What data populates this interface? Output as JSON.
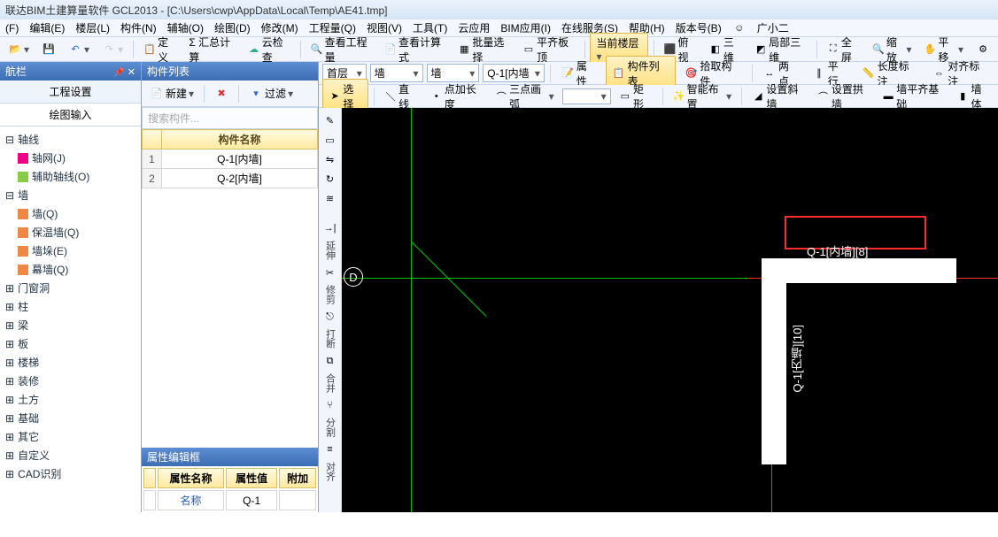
{
  "title": "联达BIM土建算量软件 GCL2013 - [C:\\Users\\cwp\\AppData\\Local\\Temp\\AE41.tmp]",
  "menu": {
    "file": "(F)",
    "edit": "编辑(E)",
    "floor": "楼层(L)",
    "component": "构件(N)",
    "aux": "辅轴(O)",
    "draw": "绘图(D)",
    "modify": "修改(M)",
    "qty": "工程量(Q)",
    "view": "视图(V)",
    "tool": "工具(T)",
    "cloud": "云应用",
    "bim": "BIM应用(I)",
    "online": "在线服务(S)",
    "help": "帮助(H)",
    "ver": "版本号(B)",
    "gxe": "广小二"
  },
  "toolbar1": {
    "define": "定义",
    "sum": "Σ 汇总计算",
    "cloudcheck": "云检查",
    "viewqty": "查看工程量",
    "viewcalc": "查看计算式",
    "batchsel": "批量选择",
    "flattop": "平齐板顶",
    "curfloor": "当前楼层",
    "topview": "俯视",
    "iso3d": "三维",
    "local3d": "局部三维",
    "fullscr": "全屏",
    "zoom": "缩放",
    "pan": "平移"
  },
  "toolbar2": {
    "floor": "首层",
    "cat": "墙",
    "subcat": "墙",
    "item": "Q-1[内墙",
    "prop": "属性",
    "complist": "构件列表",
    "pick": "拾取构件",
    "twopoint": "两点",
    "parallel": "平行",
    "lendim": "长度标注",
    "aligndim": "对齐标注"
  },
  "toolbar3": {
    "select": "选择",
    "line": "直线",
    "addlen": "点加长度",
    "arc3": "三点画弧",
    "rect": "矩形",
    "smart": "智能布置",
    "setslope": "设置斜墙",
    "setarch": "设置拱墙",
    "wallflush": "墙平齐基础",
    "wallbody": "墙体"
  },
  "nav": {
    "title": "航栏",
    "tab_setting": "工程设置",
    "tab_draw": "绘图输入",
    "tree": {
      "axis": "轴线",
      "axis_net": "轴网(J)",
      "aux_axis": "辅助轴线(O)",
      "wall": "墙",
      "wall_q": "墙(Q)",
      "wall_ins": "保温墙(Q)",
      "wall_duo": "墙垛(E)",
      "wall_curtain": "幕墙(Q)",
      "door": "门窗洞",
      "column": "柱",
      "beam": "梁",
      "slab": "板",
      "stair": "楼梯",
      "deco": "装修",
      "earth": "土方",
      "found": "基础",
      "other": "其它",
      "custom": "自定义",
      "cad": "CAD识别"
    }
  },
  "complist": {
    "title": "构件列表",
    "new": "新建",
    "filter": "过滤",
    "search_placeholder": "搜索构件...",
    "header_name": "构件名称",
    "rows": [
      {
        "num": "1",
        "name": "Q-1[内墙]"
      },
      {
        "num": "2",
        "name": "Q-2[内墙]"
      }
    ]
  },
  "prop": {
    "title": "属性编辑框",
    "col_name": "属性名称",
    "col_val": "属性值",
    "col_add": "附加",
    "row1_name": "名称",
    "row1_val": "Q-1"
  },
  "sidetools": {
    "extend": "延伸",
    "trim": "修剪",
    "break": "打断",
    "merge": "合并",
    "split": "分割",
    "align": "对齐"
  },
  "canvas": {
    "axis_label": "D",
    "wall_h_label": "Q-1[内墙][8]",
    "wall_v_label": "Q-1[内墙][10]"
  }
}
